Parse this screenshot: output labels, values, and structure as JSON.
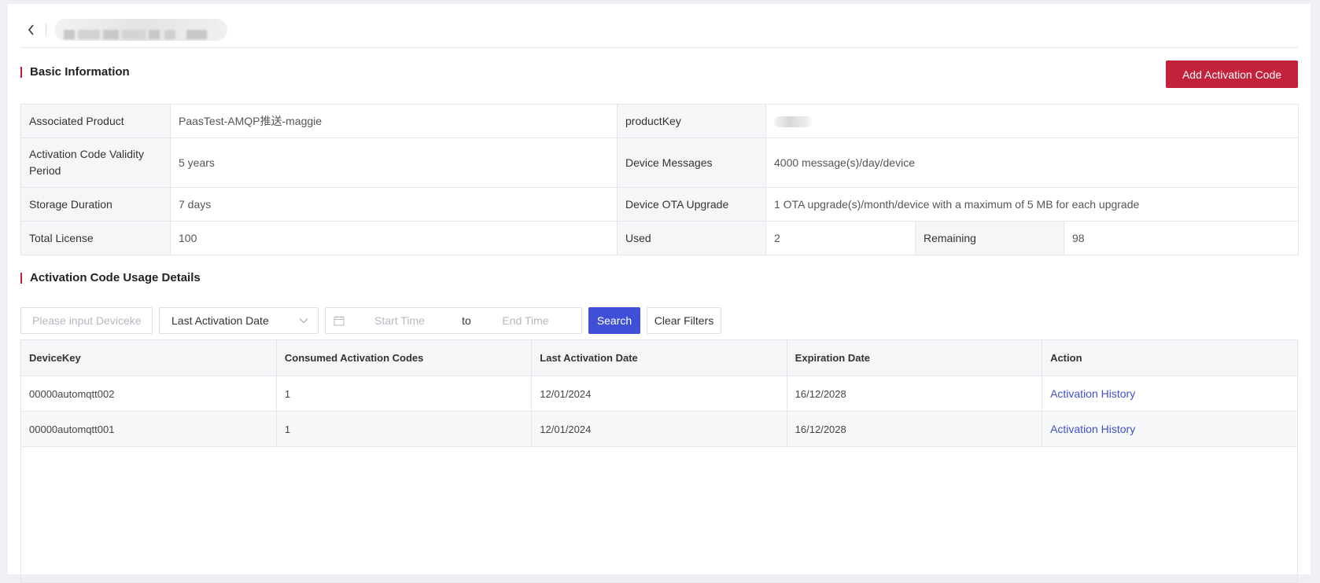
{
  "basic_info": {
    "section_title": "Basic Information",
    "add_button_label": "Add Activation Code",
    "rows": [
      [
        {
          "label": "Associated Product",
          "value": "PaasTest-AMQP推送-maggie"
        },
        {
          "label": "productKey",
          "value": ""
        }
      ],
      [
        {
          "label": "Activation Code Validity Period",
          "value": "5 years"
        },
        {
          "label": "Device Messages",
          "value": "4000 message(s)/day/device"
        }
      ],
      [
        {
          "label": "Storage Duration",
          "value": "7 days"
        },
        {
          "label": "Device OTA Upgrade",
          "value": "1 OTA upgrade(s)/month/device with a maximum of 5 MB for each upgrade"
        }
      ]
    ],
    "license_row": {
      "total_label": "Total License",
      "total_value": "100",
      "used_label": "Used",
      "used_value": "2",
      "remaining_label": "Remaining",
      "remaining_value": "98"
    }
  },
  "usage": {
    "section_title": "Activation Code Usage Details",
    "filters": {
      "devicekey_placeholder": "Please input Devicekey.",
      "date_type_selected": "Last Activation Date",
      "start_placeholder": "Start Time",
      "range_separator": "to",
      "end_placeholder": "End Time",
      "search_label": "Search",
      "clear_label": "Clear Filters"
    },
    "columns": [
      "DeviceKey",
      "Consumed Activation Codes",
      "Last Activation Date",
      "Expiration Date",
      "Action"
    ],
    "rows": [
      {
        "devicekey": "00000automqtt002",
        "consumed": "1",
        "last_activation": "12/01/2024",
        "expiration": "16/12/2028",
        "action": "Activation History"
      },
      {
        "devicekey": "00000automqtt001",
        "consumed": "1",
        "last_activation": "12/01/2024",
        "expiration": "16/12/2028",
        "action": "Activation History"
      }
    ]
  },
  "icons": {
    "back": "chevron-left-icon",
    "dropdown": "chevron-down-icon",
    "date": "calendar-icon"
  },
  "colors": {
    "primary_red": "#c4213a",
    "primary_blue": "#4050d6",
    "link": "#4050c8",
    "accent_bar": "#c41d35"
  }
}
